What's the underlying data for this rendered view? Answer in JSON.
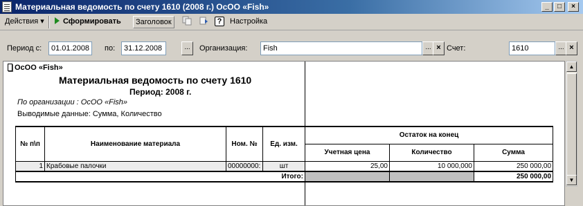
{
  "window": {
    "title": "Материальная ведомость по счету 1610 (2008 г.) ОсОО «Fish»",
    "min_glyph": "_",
    "max_glyph": "□",
    "close_glyph": "×"
  },
  "toolbar": {
    "actions_label": "Действия",
    "actions_arrow": "▾",
    "generate_label": "Сформировать",
    "header_label": "Заголовок",
    "help_glyph": "?",
    "settings_label": "Настройка"
  },
  "params": {
    "period_from_label": "Период с:",
    "period_from": "01.01.2008",
    "period_to_label": "по:",
    "period_to": "31.12.2008",
    "choose_glyph": "...",
    "clear_glyph": "×",
    "org_label": "Организация:",
    "org_value": "Fish",
    "account_label": "Счет:",
    "account_value": "1610"
  },
  "report": {
    "org_tag": "ОсОО «Fish»",
    "title": "Материальная ведомость по счету 1610",
    "period": "Период: 2008 г.",
    "org_line": "По организации : ОсОО «Fish»",
    "data_line": "Выводимые данные:  Сумма, Количество",
    "columns": {
      "num": "№ п\\п",
      "name": "Наименование материала",
      "nom": "Ном. №",
      "unit": "Ед. изм.",
      "group": "Остаток на конец",
      "price": "Учетная цена",
      "qty": "Количество",
      "sum": "Сумма"
    },
    "rows": [
      {
        "num": "1",
        "name": "Крабовые палочки",
        "nom": "00000000:",
        "unit": "шт",
        "price": "25,00",
        "qty": "10 000,000",
        "sum": "250 000,00"
      }
    ],
    "total_label": "Итого:",
    "total_sum": "250 000,00"
  },
  "scrollbar": {
    "up": "▲",
    "down": "▼"
  }
}
